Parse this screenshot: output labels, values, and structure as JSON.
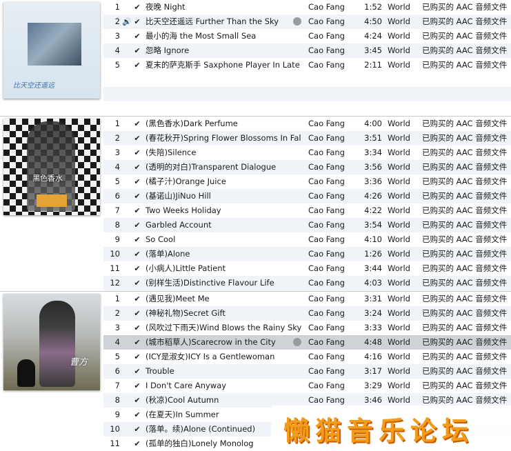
{
  "albums": [
    {
      "cover_text": "比天空还遥远",
      "tracks": [
        {
          "num": "1",
          "name": "夜晚 Night",
          "artist": "Cao Fang",
          "time": "1:52",
          "genre": "World",
          "kind": "已购买的 AAC 音频文件",
          "playing": false,
          "selected": false
        },
        {
          "num": "2",
          "name": "比天空还遥远 Further Than the Sky",
          "artist": "Cao Fang",
          "time": "4:50",
          "genre": "World",
          "kind": "已购买的 AAC 音频文件",
          "playing": true,
          "selected": false
        },
        {
          "num": "3",
          "name": "最小的海 the Most Small Sea",
          "artist": "Cao Fang",
          "time": "4:24",
          "genre": "World",
          "kind": "已购买的 AAC 音频文件",
          "playing": false,
          "selected": false
        },
        {
          "num": "4",
          "name": "忽略 Ignore",
          "artist": "Cao Fang",
          "time": "3:45",
          "genre": "World",
          "kind": "已购买的 AAC 音频文件",
          "playing": false,
          "selected": false
        },
        {
          "num": "5",
          "name": "夏末的萨克斯手 Saxphone Player In Late ...",
          "artist": "Cao Fang",
          "time": "2:11",
          "genre": "World",
          "kind": "已购买的 AAC 音频文件",
          "playing": false,
          "selected": false
        }
      ]
    },
    {
      "cover_text": "黑色香水",
      "tracks": [
        {
          "num": "1",
          "name": "(黑色香水)Dark Perfume",
          "artist": "Cao Fang",
          "time": "4:00",
          "genre": "World",
          "kind": "已购买的 AAC 音频文件"
        },
        {
          "num": "2",
          "name": "(春花秋开)Spring Flower Blossoms In Fall",
          "artist": "Cao Fang",
          "time": "3:51",
          "genre": "World",
          "kind": "已购买的 AAC 音频文件"
        },
        {
          "num": "3",
          "name": "(失陪)Silence",
          "artist": "Cao Fang",
          "time": "3:34",
          "genre": "World",
          "kind": "已购买的 AAC 音频文件"
        },
        {
          "num": "4",
          "name": "(透明的对白)Transparent Dialogue",
          "artist": "Cao Fang",
          "time": "3:56",
          "genre": "World",
          "kind": "已购买的 AAC 音频文件"
        },
        {
          "num": "5",
          "name": "(橘子汁)Orange Juice",
          "artist": "Cao Fang",
          "time": "3:36",
          "genre": "World",
          "kind": "已购买的 AAC 音频文件"
        },
        {
          "num": "6",
          "name": "(基诺山)JiNuo Hill",
          "artist": "Cao Fang",
          "time": "4:26",
          "genre": "World",
          "kind": "已购买的 AAC 音频文件"
        },
        {
          "num": "7",
          "name": "Two Weeks Holiday",
          "artist": "Cao Fang",
          "time": "4:22",
          "genre": "World",
          "kind": "已购买的 AAC 音频文件"
        },
        {
          "num": "8",
          "name": "Garbled Account",
          "artist": "Cao Fang",
          "time": "3:54",
          "genre": "World",
          "kind": "已购买的 AAC 音频文件"
        },
        {
          "num": "9",
          "name": "So Cool",
          "artist": "Cao Fang",
          "time": "4:10",
          "genre": "World",
          "kind": "已购买的 AAC 音频文件"
        },
        {
          "num": "10",
          "name": "(落单)Alone",
          "artist": "Cao Fang",
          "time": "1:26",
          "genre": "World",
          "kind": "已购买的 AAC 音频文件"
        },
        {
          "num": "11",
          "name": "(小病人)Little Patient",
          "artist": "Cao Fang",
          "time": "3:44",
          "genre": "World",
          "kind": "已购买的 AAC 音频文件"
        },
        {
          "num": "12",
          "name": "(别样生活)Distinctive Flavour Life",
          "artist": "Cao Fang",
          "time": "4:03",
          "genre": "World",
          "kind": "已购买的 AAC 音频文件"
        }
      ]
    },
    {
      "cover_text": "曹方",
      "tracks": [
        {
          "num": "1",
          "name": "(遇见我)Meet Me",
          "artist": "Cao Fang",
          "time": "3:31",
          "genre": "World",
          "kind": "已购买的 AAC 音频文件"
        },
        {
          "num": "2",
          "name": "(神秘礼物)Secret Gift",
          "artist": "Cao Fang",
          "time": "3:24",
          "genre": "World",
          "kind": "已购买的 AAC 音频文件"
        },
        {
          "num": "3",
          "name": "(风吹过下雨天)Wind Blows the Rainy Sky",
          "artist": "Cao Fang",
          "time": "3:33",
          "genre": "World",
          "kind": "已购买的 AAC 音频文件"
        },
        {
          "num": "4",
          "name": "(城市稻草人)Scarecrow in the City",
          "artist": "Cao Fang",
          "time": "4:48",
          "genre": "World",
          "kind": "已购买的 AAC 音频文件",
          "selected": true
        },
        {
          "num": "5",
          "name": "(ICY是淑女)ICY Is a Gentlewoman",
          "artist": "Cao Fang",
          "time": "4:16",
          "genre": "World",
          "kind": "已购买的 AAC 音频文件"
        },
        {
          "num": "6",
          "name": "Trouble",
          "artist": "Cao Fang",
          "time": "3:17",
          "genre": "World",
          "kind": "已购买的 AAC 音频文件"
        },
        {
          "num": "7",
          "name": "I Don't Care Anyway",
          "artist": "Cao Fang",
          "time": "3:29",
          "genre": "World",
          "kind": "已购买的 AAC 音频文件"
        },
        {
          "num": "8",
          "name": "(秋凉)Cool Autumn",
          "artist": "Cao Fang",
          "time": "3:46",
          "genre": "World",
          "kind": "已购买的 AAC 音频文件"
        },
        {
          "num": "9",
          "name": "(在夏天)In Summer",
          "artist": "",
          "time": "",
          "genre": "",
          "kind": ""
        },
        {
          "num": "10",
          "name": "(落单。续)Alone (Continued)",
          "artist": "",
          "time": "",
          "genre": "",
          "kind": ""
        },
        {
          "num": "11",
          "name": "(孤单的独白)Lonely Monolog",
          "artist": "",
          "time": "",
          "genre": "",
          "kind": ""
        }
      ]
    }
  ],
  "checkmark": "✔",
  "speaker_glyph": "🔊",
  "watermark": "懒猫音乐论坛",
  "colors": {
    "row_alt": "#f0f3f8",
    "row_selected": "#cfd2d6",
    "watermark": "#f39c1a"
  }
}
